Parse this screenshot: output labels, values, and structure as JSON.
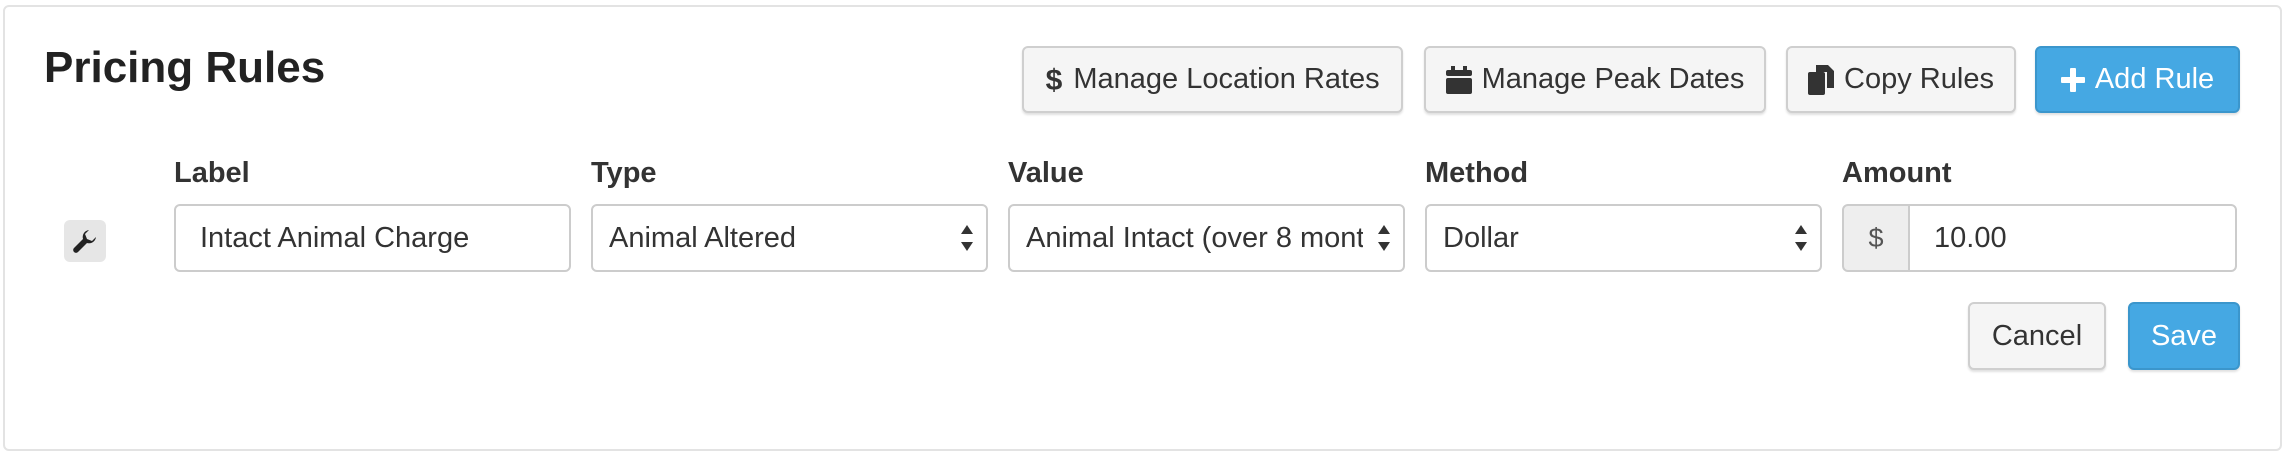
{
  "title": "Pricing Rules",
  "toolbar": {
    "manage_location_rates": "Manage Location Rates",
    "manage_peak_dates": "Manage Peak Dates",
    "copy_rules": "Copy Rules",
    "add_rule": "Add Rule"
  },
  "columns": {
    "label": "Label",
    "type": "Type",
    "value": "Value",
    "method": "Method",
    "amount": "Amount"
  },
  "rule": {
    "label_value": "Intact Animal Charge",
    "type_selected": "Animal Altered",
    "value_selected": "Animal Intact (over 8 mont",
    "method_selected": "Dollar",
    "currency_symbol": "$",
    "amount_value": "10.00"
  },
  "actions": {
    "cancel": "Cancel",
    "save": "Save"
  },
  "colors": {
    "primary": "#45a8e3",
    "default_button": "#f5f5f5",
    "border": "#cccccc"
  },
  "icons": {
    "location_rates": "dollar-icon",
    "peak_dates": "calendar-icon",
    "copy": "copy-icon",
    "add": "plus-icon",
    "row": "wrench-icon",
    "select": "sort-caret-icon"
  }
}
